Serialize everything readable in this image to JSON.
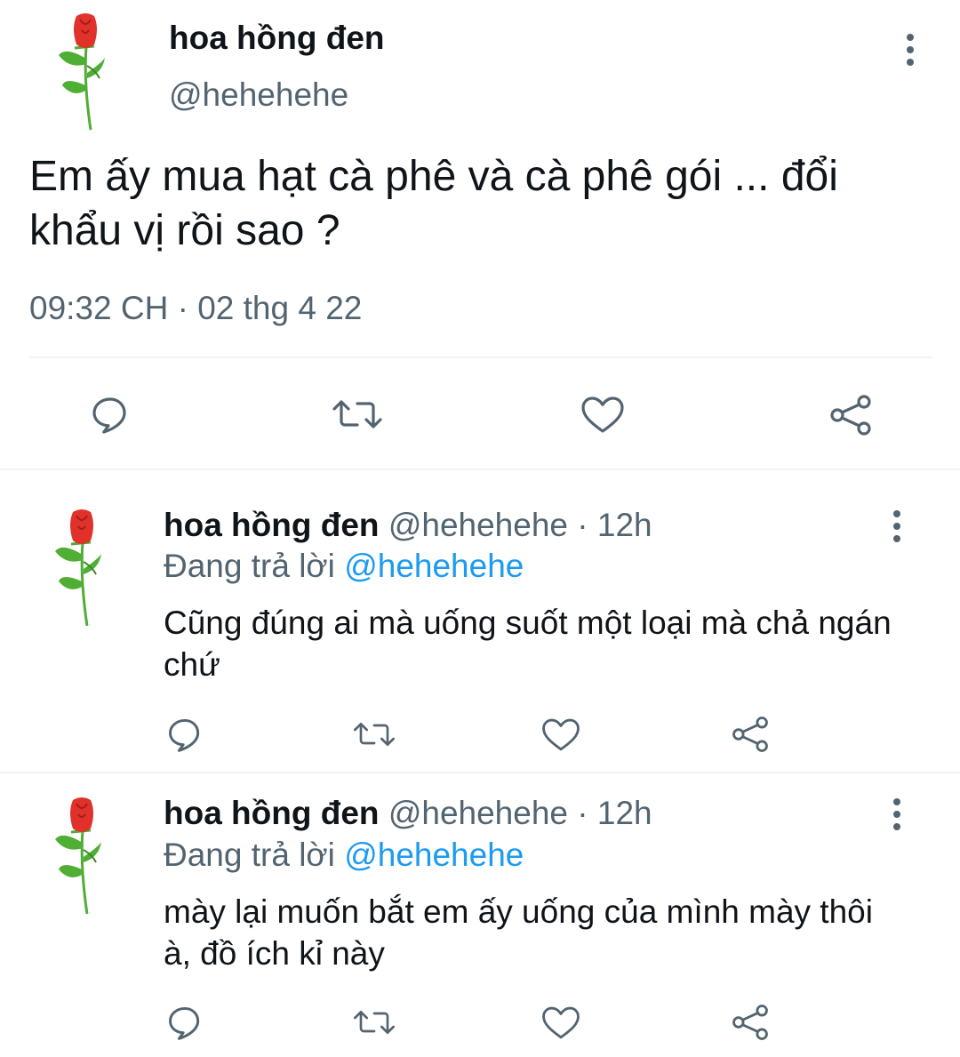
{
  "main_tweet": {
    "name": "hoa hồng đen",
    "handle": "@hehehehe",
    "text": "Em ấy mua hạt cà phê và cà phê gói ... đổi khẩu vị rồi sao ?",
    "timestamp": "09:32 CH · 02 thg 4 22"
  },
  "replies": [
    {
      "name": "hoa hồng đen",
      "handle": "@hehehehe",
      "time": "12h",
      "replying_prefix": "Đang trả lời",
      "replying_to": "@hehehehe",
      "text": "Cũng đúng ai mà uống suốt một loại mà chả ngán chứ"
    },
    {
      "name": "hoa hồng đen",
      "handle": "@hehehehe",
      "time": "12h",
      "replying_prefix": "Đang trả lời",
      "replying_to": "@hehehehe",
      "text": "mày lại muốn bắt em ấy uống của mình mày thôi à, đồ ích kỉ này"
    }
  ],
  "icons": {
    "avatar": "rose-icon",
    "actions": [
      "reply-icon",
      "retweet-icon",
      "like-icon",
      "share-icon"
    ],
    "menu": "more-vertical-icon"
  },
  "colors": {
    "text": "#0f1419",
    "secondary": "#536471",
    "link": "#1d9bf0",
    "divider": "#eff3f4",
    "rose_red": "#e0312b",
    "leaf_green": "#4fae34"
  }
}
